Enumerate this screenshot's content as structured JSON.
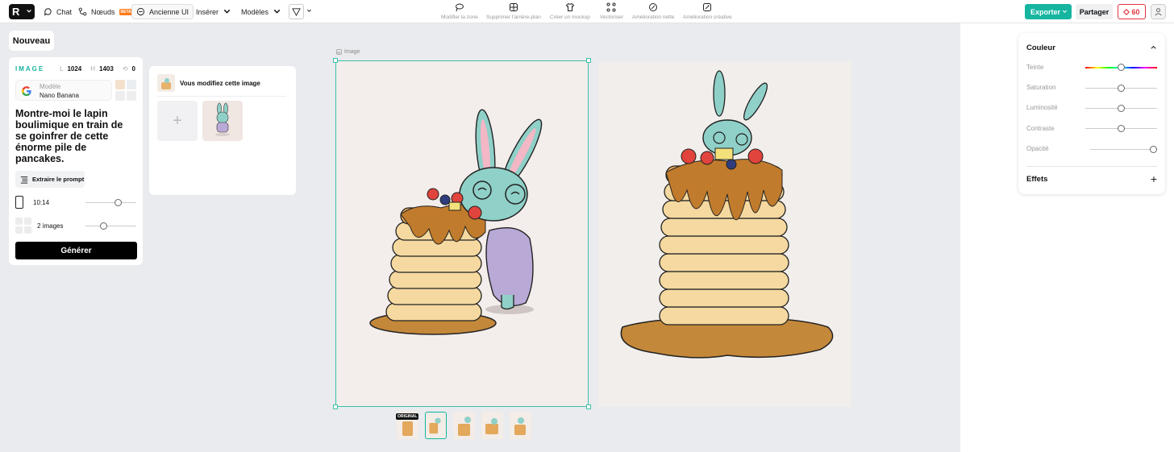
{
  "topbar": {
    "chat": "Chat",
    "noeuds": "Nœuds",
    "beta": "BETA",
    "ancienne_ui": "Ancienne UI",
    "inserer": "Insérer",
    "modeles": "Modèles",
    "tools": [
      "Modifier la zone",
      "Supprimer l'arrière-plan",
      "Créer un mockup",
      "Vectoriser",
      "Amélioration nette",
      "Amélioration créative"
    ],
    "exporter": "Exporter",
    "partager": "Partager",
    "credits": "60"
  },
  "left": {
    "nouveau": "Nouveau",
    "image_label": "IMAGE",
    "width_key": "L",
    "width": "1024",
    "height_key": "H",
    "height": "1403",
    "seed": "0",
    "model_label": "Modèle",
    "model_name": "Nano Banana",
    "prompt": "Montre-moi le lapin boulimique en train de se goinfrer de cette énorme pile de pancakes.",
    "extract_label": "Extraire le prompt",
    "ratio": "10:14",
    "count": "2 images",
    "generate": "Générer",
    "ratio_slider_level": 0.65,
    "count_slider_level": 0.35
  },
  "edit": {
    "title": "Vous modifiez cette image",
    "add": "+"
  },
  "canvas": {
    "label": "Image",
    "original_tag": "ORIGINAL",
    "thumb_count": 5,
    "active_thumb": 1
  },
  "props": {
    "couleur": "Couleur",
    "rows": [
      "Teinte",
      "Saturation",
      "Luminosité",
      "Contraste",
      "Opacité"
    ],
    "effets": "Effets"
  },
  "colors": {
    "accent": "#15b5a0",
    "credits": "#e0343e"
  }
}
